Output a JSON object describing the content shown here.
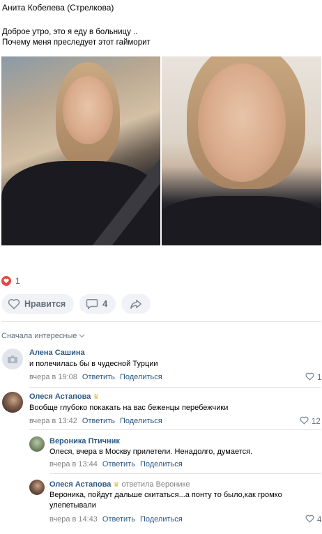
{
  "post": {
    "author": "Анита Кобелева (Стрелкова)",
    "text_line1": "Доброе утро, это я еду в больницу ..",
    "text_line2": "Почему меня преследует этот гайморит"
  },
  "reactions": {
    "likes_count": "1"
  },
  "actions": {
    "like_label": "Нравится",
    "comments_count": "4"
  },
  "comments_sort": "Сначала интересные",
  "comments": [
    {
      "author": "Алена Сашина",
      "text": "и полечилась бы в чудесной Турции",
      "time": "вчера в 19:08",
      "reply": "Ответить",
      "share": "Поделиться",
      "likes": "1"
    },
    {
      "author": "Олеся Астапова",
      "text": "Вообще глубоко покакать на вас беженцы перебежчики",
      "time": "вчера в 13:42",
      "reply": "Ответить",
      "share": "Поделиться",
      "likes": "12"
    },
    {
      "author": "Вероника Птичник",
      "text": "Олеся, вчера в Москву прилетели. Ненадолго, думается.",
      "time": "вчера в 13:44",
      "reply": "Ответить",
      "share": "Поделиться"
    },
    {
      "author": "Олеся Астапова",
      "reply_to": "ответила Веронике",
      "text_line1": "Вероника, пойдут дальше скитаться...а понту то было,как громко",
      "text_line2": "улепетывали",
      "time": "вчера в 14:43",
      "reply": "Ответить",
      "share": "Поделиться",
      "likes": "4"
    }
  ],
  "colors": {
    "link": "#2a5885",
    "muted": "#828282",
    "heart": "#e64646",
    "button_bg": "#f0f2f5"
  }
}
